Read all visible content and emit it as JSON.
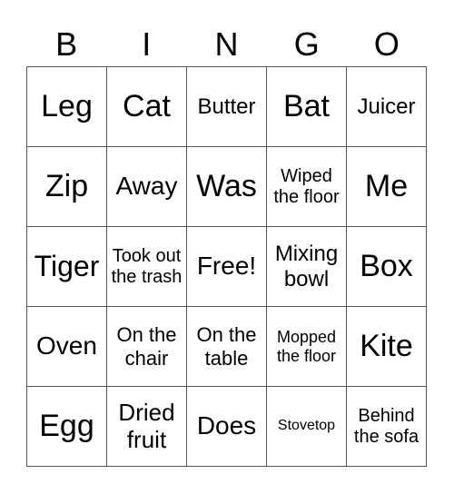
{
  "header": [
    "B",
    "I",
    "N",
    "G",
    "O"
  ],
  "cells": [
    [
      "Leg",
      "Cat",
      "Butter",
      "Bat",
      "Juicer"
    ],
    [
      "Zip",
      "Away",
      "Was",
      "Wiped the floor",
      "Me"
    ],
    [
      "Tiger",
      "Took out the trash",
      "Free!",
      "Mixing bowl",
      "Box"
    ],
    [
      "Oven",
      "On the chair",
      "On the table",
      "Mopped the floor",
      "Kite"
    ],
    [
      "Egg",
      "Dried fruit",
      "Does",
      "Stovetop",
      "Behind the sofa"
    ]
  ]
}
